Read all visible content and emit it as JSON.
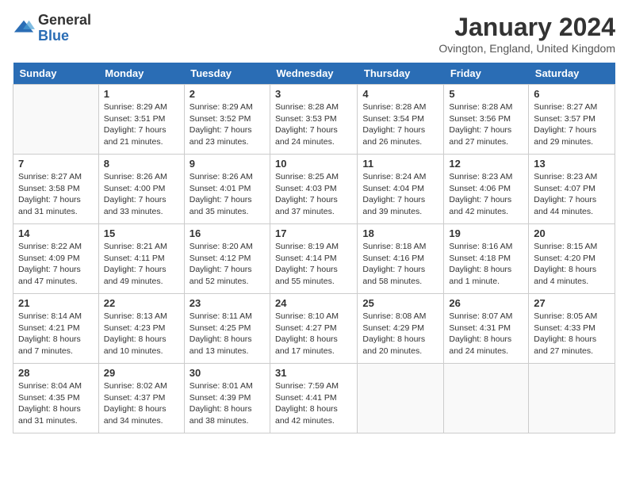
{
  "logo": {
    "general": "General",
    "blue": "Blue"
  },
  "title": "January 2024",
  "location": "Ovington, England, United Kingdom",
  "headers": [
    "Sunday",
    "Monday",
    "Tuesday",
    "Wednesday",
    "Thursday",
    "Friday",
    "Saturday"
  ],
  "weeks": [
    [
      {
        "num": "",
        "info": ""
      },
      {
        "num": "1",
        "info": "Sunrise: 8:29 AM\nSunset: 3:51 PM\nDaylight: 7 hours\nand 21 minutes."
      },
      {
        "num": "2",
        "info": "Sunrise: 8:29 AM\nSunset: 3:52 PM\nDaylight: 7 hours\nand 23 minutes."
      },
      {
        "num": "3",
        "info": "Sunrise: 8:28 AM\nSunset: 3:53 PM\nDaylight: 7 hours\nand 24 minutes."
      },
      {
        "num": "4",
        "info": "Sunrise: 8:28 AM\nSunset: 3:54 PM\nDaylight: 7 hours\nand 26 minutes."
      },
      {
        "num": "5",
        "info": "Sunrise: 8:28 AM\nSunset: 3:56 PM\nDaylight: 7 hours\nand 27 minutes."
      },
      {
        "num": "6",
        "info": "Sunrise: 8:27 AM\nSunset: 3:57 PM\nDaylight: 7 hours\nand 29 minutes."
      }
    ],
    [
      {
        "num": "7",
        "info": "Sunrise: 8:27 AM\nSunset: 3:58 PM\nDaylight: 7 hours\nand 31 minutes."
      },
      {
        "num": "8",
        "info": "Sunrise: 8:26 AM\nSunset: 4:00 PM\nDaylight: 7 hours\nand 33 minutes."
      },
      {
        "num": "9",
        "info": "Sunrise: 8:26 AM\nSunset: 4:01 PM\nDaylight: 7 hours\nand 35 minutes."
      },
      {
        "num": "10",
        "info": "Sunrise: 8:25 AM\nSunset: 4:03 PM\nDaylight: 7 hours\nand 37 minutes."
      },
      {
        "num": "11",
        "info": "Sunrise: 8:24 AM\nSunset: 4:04 PM\nDaylight: 7 hours\nand 39 minutes."
      },
      {
        "num": "12",
        "info": "Sunrise: 8:23 AM\nSunset: 4:06 PM\nDaylight: 7 hours\nand 42 minutes."
      },
      {
        "num": "13",
        "info": "Sunrise: 8:23 AM\nSunset: 4:07 PM\nDaylight: 7 hours\nand 44 minutes."
      }
    ],
    [
      {
        "num": "14",
        "info": "Sunrise: 8:22 AM\nSunset: 4:09 PM\nDaylight: 7 hours\nand 47 minutes."
      },
      {
        "num": "15",
        "info": "Sunrise: 8:21 AM\nSunset: 4:11 PM\nDaylight: 7 hours\nand 49 minutes."
      },
      {
        "num": "16",
        "info": "Sunrise: 8:20 AM\nSunset: 4:12 PM\nDaylight: 7 hours\nand 52 minutes."
      },
      {
        "num": "17",
        "info": "Sunrise: 8:19 AM\nSunset: 4:14 PM\nDaylight: 7 hours\nand 55 minutes."
      },
      {
        "num": "18",
        "info": "Sunrise: 8:18 AM\nSunset: 4:16 PM\nDaylight: 7 hours\nand 58 minutes."
      },
      {
        "num": "19",
        "info": "Sunrise: 8:16 AM\nSunset: 4:18 PM\nDaylight: 8 hours\nand 1 minute."
      },
      {
        "num": "20",
        "info": "Sunrise: 8:15 AM\nSunset: 4:20 PM\nDaylight: 8 hours\nand 4 minutes."
      }
    ],
    [
      {
        "num": "21",
        "info": "Sunrise: 8:14 AM\nSunset: 4:21 PM\nDaylight: 8 hours\nand 7 minutes."
      },
      {
        "num": "22",
        "info": "Sunrise: 8:13 AM\nSunset: 4:23 PM\nDaylight: 8 hours\nand 10 minutes."
      },
      {
        "num": "23",
        "info": "Sunrise: 8:11 AM\nSunset: 4:25 PM\nDaylight: 8 hours\nand 13 minutes."
      },
      {
        "num": "24",
        "info": "Sunrise: 8:10 AM\nSunset: 4:27 PM\nDaylight: 8 hours\nand 17 minutes."
      },
      {
        "num": "25",
        "info": "Sunrise: 8:08 AM\nSunset: 4:29 PM\nDaylight: 8 hours\nand 20 minutes."
      },
      {
        "num": "26",
        "info": "Sunrise: 8:07 AM\nSunset: 4:31 PM\nDaylight: 8 hours\nand 24 minutes."
      },
      {
        "num": "27",
        "info": "Sunrise: 8:05 AM\nSunset: 4:33 PM\nDaylight: 8 hours\nand 27 minutes."
      }
    ],
    [
      {
        "num": "28",
        "info": "Sunrise: 8:04 AM\nSunset: 4:35 PM\nDaylight: 8 hours\nand 31 minutes."
      },
      {
        "num": "29",
        "info": "Sunrise: 8:02 AM\nSunset: 4:37 PM\nDaylight: 8 hours\nand 34 minutes."
      },
      {
        "num": "30",
        "info": "Sunrise: 8:01 AM\nSunset: 4:39 PM\nDaylight: 8 hours\nand 38 minutes."
      },
      {
        "num": "31",
        "info": "Sunrise: 7:59 AM\nSunset: 4:41 PM\nDaylight: 8 hours\nand 42 minutes."
      },
      {
        "num": "",
        "info": ""
      },
      {
        "num": "",
        "info": ""
      },
      {
        "num": "",
        "info": ""
      }
    ]
  ]
}
